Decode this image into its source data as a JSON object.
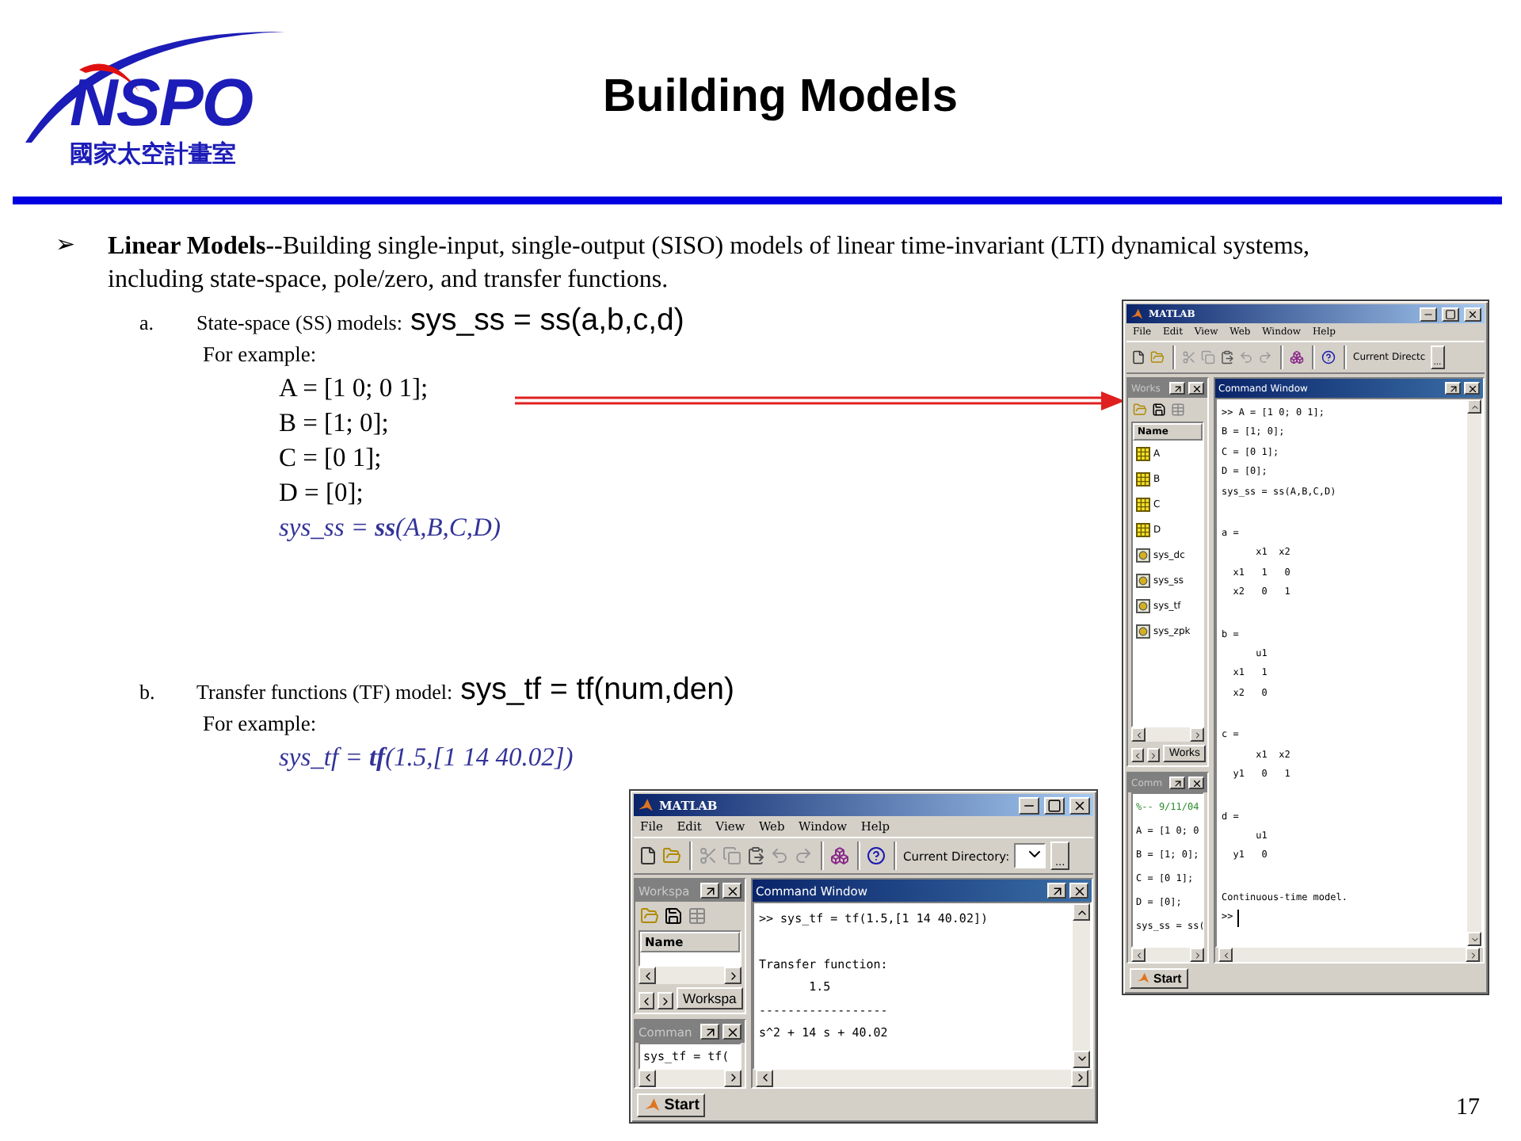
{
  "logo": {
    "wordmark": "NSPO",
    "subtitle": "國家太空計畫室"
  },
  "title": "Building Models",
  "bullet": {
    "marker": "➢",
    "text": "**Linear Models--**Building single-input, single-output (SISO) models of linear time-invariant (LTI) dynamical systems, including state-space, pole/zero, and transfer functions."
  },
  "items": [
    {
      "marker": "a.",
      "label": "State-space (SS) models:",
      "syntax": "sys_ss = ss(a,b,c,d)",
      "example_label": "For example:",
      "code": [
        {
          "kind": "plain",
          "text": "A = [1 0; 0 1];"
        },
        {
          "kind": "plain",
          "text": "B = [1; 0];"
        },
        {
          "kind": "plain",
          "text": "C = [0 1];"
        },
        {
          "kind": "plain",
          "text": "D = [0];"
        },
        {
          "kind": "matlab",
          "text": "sys_ss = **ss**(A,B,C,D)"
        }
      ]
    },
    {
      "marker": "b.",
      "label": "Transfer functions (TF) model:",
      "syntax": "sys_tf = tf(num,den)",
      "example_label": "For example:",
      "code": [
        {
          "kind": "matlab",
          "text": "sys_tf = **tf**(1.5,[1 14 40.02])"
        }
      ]
    }
  ],
  "windows": [
    {
      "title": "MATLAB",
      "menus": [
        "File",
        "Edit",
        "View",
        "Web",
        "Window",
        "Help"
      ],
      "current_directory": {
        "label": "Current Directc",
        "show_dropdown": false,
        "browse": "..."
      },
      "workspace": {
        "title": "Works",
        "column": "Name",
        "items": [
          {
            "kind": "matrix",
            "name": "A"
          },
          {
            "kind": "matrix",
            "name": "B"
          },
          {
            "kind": "matrix",
            "name": "C"
          },
          {
            "kind": "matrix",
            "name": "D"
          },
          {
            "kind": "object",
            "name": "sys_dc"
          },
          {
            "kind": "object",
            "name": "sys_ss"
          },
          {
            "kind": "object",
            "name": "sys_tf"
          },
          {
            "kind": "object",
            "name": "sys_zpk"
          }
        ],
        "tab": "Works"
      },
      "history": {
        "title": "Comm",
        "lines": [
          {
            "kind": "session",
            "text": "%-- 9/11/04"
          },
          {
            "kind": "command",
            "text": "A = [1 0; 0"
          },
          {
            "kind": "command",
            "text": "B = [1; 0];"
          },
          {
            "kind": "command",
            "text": "C = [0 1];"
          },
          {
            "kind": "command",
            "text": "D = [0];"
          },
          {
            "kind": "command",
            "text": "sys_ss = ss("
          }
        ]
      },
      "command_window": {
        "title": "Command Window",
        "cursor": true,
        "blocks": [
          [
            ">> A = [1 0; 0 1];",
            "B = [1; 0];",
            "C = [0 1];",
            "D = [0];",
            "sys_ss = ss(A,B,C,D)"
          ],
          [
            "a =",
            "      x1  x2",
            "  x1   1   0",
            "  x2   0   1"
          ],
          [
            "b =",
            "      u1",
            "  x1   1",
            "  x2   0"
          ],
          [
            "c =",
            "      x1  x2",
            "  y1   0   1"
          ],
          [
            "d =",
            "      u1",
            "  y1   0"
          ],
          [
            "Continuous-time model.",
            ">>"
          ]
        ]
      },
      "start": "Start"
    },
    {
      "title": "MATLAB",
      "menus": [
        "File",
        "Edit",
        "View",
        "Web",
        "Window",
        "Help"
      ],
      "current_directory": {
        "label": "Current Directory:",
        "show_dropdown": true,
        "browse": "..."
      },
      "workspace": {
        "title": "Workspa",
        "column": "Name",
        "tab": "Workspa"
      },
      "history": {
        "title": "Comman",
        "lines": [
          {
            "kind": "command",
            "text": "sys_tf = tf("
          }
        ]
      },
      "command_window": {
        "title": "Command Window",
        "cursor": false,
        "blocks": [
          [
            ">> sys_tf = tf(1.5,[1 14 40.02])"
          ],
          [
            "Transfer function:",
            "       1.5",
            "------------------",
            "s^2 + 14 s + 40.02"
          ]
        ]
      },
      "start": "Start"
    }
  ],
  "page_number": "17"
}
